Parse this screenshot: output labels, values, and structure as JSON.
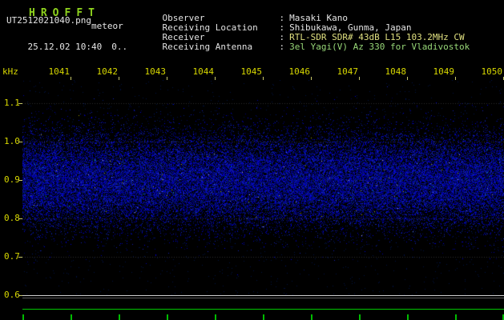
{
  "header": {
    "title_letters": [
      "H",
      "R",
      "O",
      "F",
      "F",
      "T"
    ],
    "file_name": "UT2512021040.png",
    "observation_name": "meteor",
    "datetime": "25.12.02 10:40",
    "counter": "0..",
    "colon": ":",
    "info_rows": [
      {
        "label": "Observer",
        "value": "Masaki Kano"
      },
      {
        "label": "Receiving Location",
        "value": "Shibukawa, Gunma, Japan"
      },
      {
        "label": "Receiver",
        "value": "RTL-SDR SDR# 43dB L15 103.2MHz CW"
      },
      {
        "label": "Receiving Antenna",
        "value": "3el Yagi(V) Az 330 for Vladivostok"
      }
    ]
  },
  "axes": {
    "y_unit_label": "kHz",
    "y_tick_labels": [
      "1.1",
      "1.0",
      "0.9",
      "0.8",
      "0.7",
      "0.6"
    ],
    "x_tick_labels": [
      "1041",
      "1042",
      "1043",
      "1044",
      "1045",
      "1046",
      "1047",
      "1048",
      "1049",
      "1050"
    ]
  },
  "spectrogram": {
    "description": "broadband blue noise band",
    "band_center_khz": 0.9,
    "band_sigma_khz": 0.058,
    "band_range_khz": [
      0.78,
      1.02
    ]
  },
  "colors": {
    "title_text": "#8fd41e",
    "axis_text": "#d8d800",
    "white_text": "#e6e6e6",
    "receiver_value": "#e0e080",
    "antenna_value": "#98d878",
    "trace_green": "#00c800",
    "noise_blue": "#0000cc"
  }
}
